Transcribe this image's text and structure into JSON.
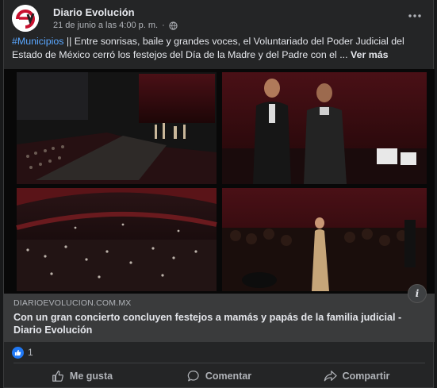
{
  "post": {
    "page_name": "Diario Evolución",
    "timestamp": "21 de junio a las 4:00 p. m.",
    "dot": "·",
    "hashtag": "#Municipios",
    "body": " || Entre sonrisas, baile y grandes voces, el Voluntariado del Poder Judicial del Estado de México cerró los festejos del Día de la Madre y del Padre con el ...",
    "see_more": "Ver más"
  },
  "link": {
    "domain": "DIARIOEVOLUCION.COM.MX",
    "title": "Con un gran concierto concluyen festejos a mamás y papás de la familia judicial - Diario Evolución",
    "info": "i"
  },
  "reactions": {
    "count": "1"
  },
  "actions": {
    "like": "Me gusta",
    "comment": "Comentar",
    "share": "Compartir"
  },
  "colors": {
    "background": "#18191a",
    "card": "#242526",
    "link_preview": "#3a3b3c",
    "hashtag": "#5aa7ff",
    "like_blue": "#2078f4",
    "brand_red": "#c8102e"
  },
  "icons": {
    "avatar": "diario-evolucion-logo",
    "globe": "globe-icon",
    "more": "more-options-icon",
    "info": "info-icon",
    "like": "thumbs-up-icon",
    "comment": "comment-bubble-icon",
    "share": "share-arrow-icon"
  }
}
